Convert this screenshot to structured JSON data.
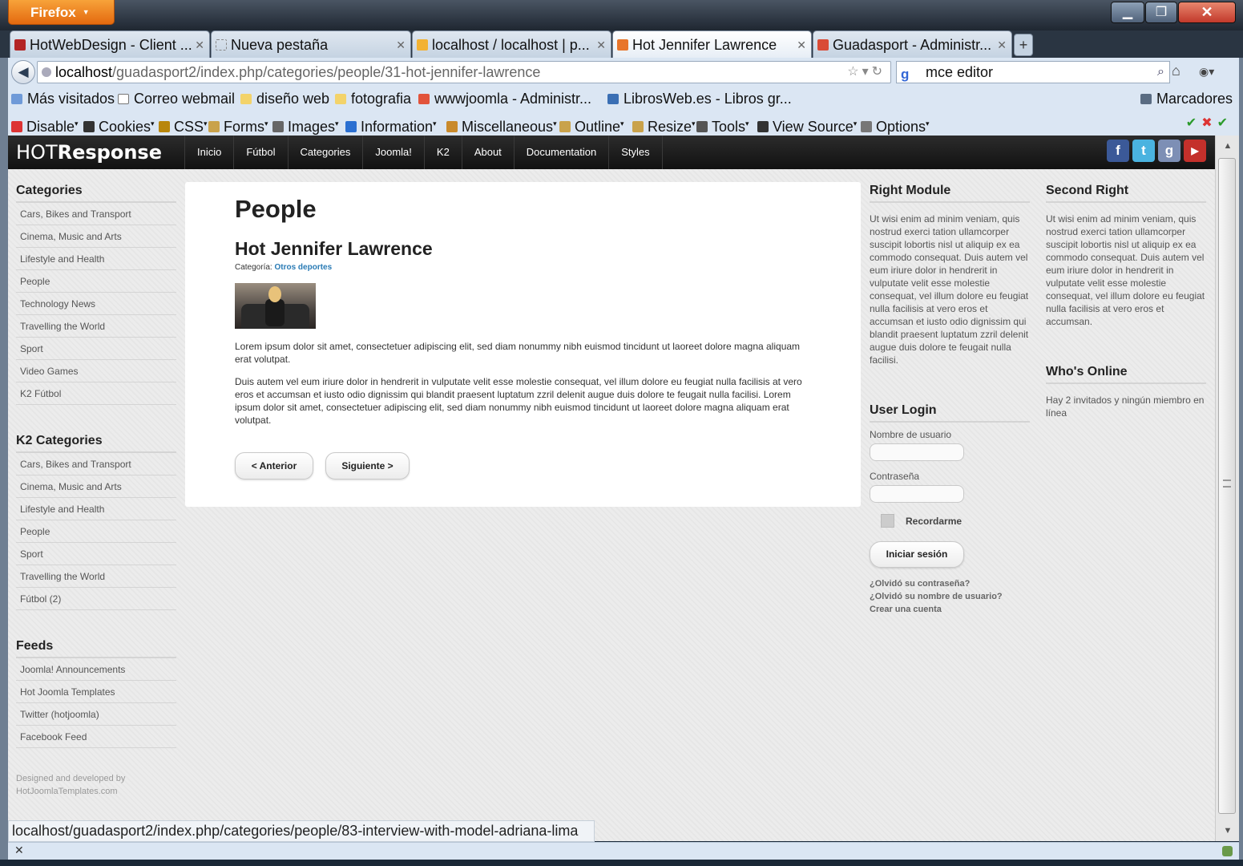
{
  "browser": {
    "app_button": "Firefox",
    "window_controls": {
      "minimize": "▁",
      "maximize": "❐",
      "close": "✕"
    },
    "tabs": [
      {
        "label": "HotWebDesign - Client ...",
        "icon_color": "#b32424",
        "active": false
      },
      {
        "label": "Nueva pestaña",
        "icon_color": "#ffffff",
        "active": false
      },
      {
        "label": "localhost / localhost | p...",
        "icon_color": "#f2b233",
        "active": false
      },
      {
        "label": "Hot Jennifer Lawrence",
        "icon_color": "#e8752a",
        "active": true
      },
      {
        "label": "Guadasport - Administr...",
        "icon_color": "#d94b36",
        "active": false
      }
    ],
    "new_tab": "+",
    "url_host": "localhost",
    "url_path": "/guadasport2/index.php/categories/people/31-hot-jennifer-lawrence",
    "search_value": "mce editor",
    "bookmarks": [
      {
        "label": "Más visitados",
        "icon": "most-visited-icon"
      },
      {
        "label": "Correo webmail",
        "icon": "mail-icon"
      },
      {
        "label": "diseño web",
        "icon": "folder-icon"
      },
      {
        "label": "fotografia",
        "icon": "folder-icon"
      },
      {
        "label": "wwwjoomla - Administr...",
        "icon": "joomla-icon"
      },
      {
        "label": "LibrosWeb.es - Libros gr...",
        "icon": "book-icon"
      }
    ],
    "bookmarks_menu": "Marcadores",
    "devtools": [
      {
        "label": "Disable",
        "icon": "disable-icon",
        "color": "#d33"
      },
      {
        "label": "Cookies",
        "icon": "cookies-icon",
        "color": "#333"
      },
      {
        "label": "CSS",
        "icon": "css-icon",
        "color": "#b8860b"
      },
      {
        "label": "Forms",
        "icon": "forms-icon",
        "color": "#c9a24b"
      },
      {
        "label": "Images",
        "icon": "images-icon",
        "color": "#666"
      },
      {
        "label": "Information",
        "icon": "information-icon",
        "color": "#2a6fd1"
      },
      {
        "label": "Miscellaneous",
        "icon": "miscellaneous-icon",
        "color": "#c98a2b"
      },
      {
        "label": "Outline",
        "icon": "outline-icon",
        "color": "#c9a24b"
      },
      {
        "label": "Resize",
        "icon": "resize-icon",
        "color": "#c9a24b"
      },
      {
        "label": "Tools",
        "icon": "tools-icon",
        "color": "#555"
      },
      {
        "label": "View Source",
        "icon": "view-source-icon",
        "color": "#333"
      },
      {
        "label": "Options",
        "icon": "options-icon",
        "color": "#777"
      }
    ],
    "status_url": "localhost/guadasport2/index.php/categories/people/83-interview-with-model-adriana-lima"
  },
  "site": {
    "logo_light": "HOT",
    "logo_bold": "Response",
    "menu": [
      "Inicio",
      "Fútbol",
      "Categories",
      "Joomla!",
      "K2",
      "About",
      "Documentation",
      "Styles"
    ],
    "social": [
      {
        "name": "facebook-icon",
        "glyph": "f",
        "color": "#3b5998"
      },
      {
        "name": "twitter-icon",
        "glyph": "t",
        "color": "#4ab3e0"
      },
      {
        "name": "google-icon",
        "glyph": "g",
        "color": "#7d8fb5"
      },
      {
        "name": "youtube-icon",
        "glyph": "▶",
        "color": "#c4302b"
      }
    ]
  },
  "left": {
    "categories_title": "Categories",
    "categories": [
      "Cars, Bikes and Transport",
      "Cinema, Music and Arts",
      "Lifestyle and Health",
      "People",
      "Technology News",
      "Travelling the World",
      "Sport",
      "Video Games",
      "K2 Fútbol"
    ],
    "k2_title": "K2 Categories",
    "k2_categories": [
      "Cars, Bikes and Transport",
      "Cinema, Music and Arts",
      "Lifestyle and Health",
      "People",
      "Sport",
      "Travelling the World",
      "Fútbol (2)"
    ],
    "feeds_title": "Feeds",
    "feeds": [
      "Joomla! Announcements",
      "Hot Joomla Templates",
      "Twitter (hotjoomla)",
      "Facebook Feed"
    ],
    "credit_line1": "Designed and developed by",
    "credit_line2": "HotJoomlaTemplates.com"
  },
  "article": {
    "page_heading": "People",
    "title": "Hot Jennifer Lawrence",
    "category_label": "Categoría:",
    "category_link": "Otros deportes",
    "para1": "Lorem ipsum dolor sit amet, consectetuer adipiscing elit, sed diam nonummy nibh euismod tincidunt ut laoreet dolore magna aliquam erat volutpat.",
    "para2": "Duis autem vel eum iriure dolor in hendrerit in vulputate velit esse molestie consequat, vel illum dolore eu feugiat nulla facilisis at vero eros et accumsan et iusto odio dignissim qui blandit praesent luptatum zzril delenit augue duis dolore te feugait nulla facilisi. Lorem ipsum dolor sit amet, consectetuer adipiscing elit, sed diam nonummy nibh euismod tincidunt ut laoreet dolore magna aliquam erat volutpat.",
    "prev": "< Anterior",
    "next": "Siguiente >"
  },
  "right": {
    "module_title": "Right Module",
    "module_text": "Ut wisi enim ad minim veniam, quis nostrud exerci tation ullamcorper suscipit lobortis nisl ut aliquip ex ea commodo consequat. Duis autem vel eum iriure dolor in hendrerit in vulputate velit esse molestie consequat, vel illum dolore eu feugiat nulla facilisis at vero eros et accumsan et iusto odio dignissim qui blandit praesent luptatum zzril delenit augue duis dolore te feugait nulla facilisi.",
    "login_title": "User Login",
    "username_label": "Nombre de usuario",
    "password_label": "Contraseña",
    "remember_label": "Recordarme",
    "login_button": "Iniciar sesión",
    "forgot_password": "¿Olvidó su contraseña?",
    "forgot_username": "¿Olvidó su nombre de usuario?",
    "create_account": "Crear una cuenta"
  },
  "second": {
    "title": "Second Right",
    "text": "Ut wisi enim ad minim veniam, quis nostrud exerci tation ullamcorper suscipit lobortis nisl ut aliquip ex ea commodo consequat. Duis autem vel eum iriure dolor in hendrerit in vulputate velit esse molestie consequat, vel illum dolore eu feugiat nulla facilisis at vero eros et accumsan.",
    "online_title": "Who's Online",
    "online_text": "Hay 2 invitados y ningún miembro en línea"
  },
  "colors": {
    "accent_link": "#2a7bb5",
    "header_dark": "#1a1a1a",
    "firefox_orange": "#e4690f"
  }
}
